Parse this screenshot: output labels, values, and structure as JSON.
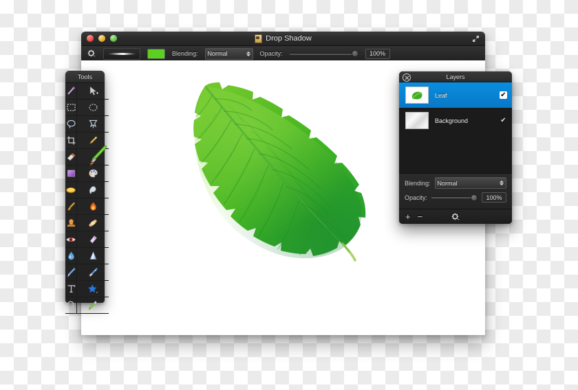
{
  "window": {
    "title": "Drop Shadow",
    "title_icon": "document-icon",
    "traffic_lights": [
      "close",
      "minimize",
      "zoom"
    ],
    "expand_icon": "expand-arrows-icon"
  },
  "toolbar": {
    "gear_icon": "gear-icon",
    "brush_preview_label": "Brush preview",
    "color_swatch": "#5bd01e",
    "blending_label": "Blending:",
    "blending_value": "Normal",
    "opacity_label": "Opacity:",
    "opacity_value": "100%",
    "opacity_percent": 100
  },
  "tools": {
    "title": "Tools",
    "active_index": 9,
    "items": [
      {
        "name": "magic-wand-tool",
        "icon": "magic-wand-icon"
      },
      {
        "name": "move-tool",
        "icon": "arrow-move-icon"
      },
      {
        "name": "rectangular-marquee-tool",
        "icon": "rect-select-icon"
      },
      {
        "name": "elliptical-marquee-tool",
        "icon": "ellipse-select-icon"
      },
      {
        "name": "lasso-tool",
        "icon": "lasso-icon"
      },
      {
        "name": "polygonal-lasso-tool",
        "icon": "polygon-lasso-icon"
      },
      {
        "name": "crop-tool",
        "icon": "crop-icon"
      },
      {
        "name": "pencil-tool",
        "icon": "pencil-icon"
      },
      {
        "name": "eraser-tool",
        "icon": "eraser-icon"
      },
      {
        "name": "paintbrush-tool",
        "icon": "paintbrush-icon"
      },
      {
        "name": "gradient-tool",
        "icon": "gradient-icon"
      },
      {
        "name": "clone-stamp-tool",
        "icon": "palette-icon"
      },
      {
        "name": "paint-bucket-tool",
        "icon": "paint-bucket-icon"
      },
      {
        "name": "smudge-tool",
        "icon": "smudge-icon"
      },
      {
        "name": "blur-tool",
        "icon": "blur-brush-icon"
      },
      {
        "name": "burn-tool",
        "icon": "flame-icon"
      },
      {
        "name": "stamp-tool",
        "icon": "rubber-stamp-icon"
      },
      {
        "name": "bandage-tool",
        "icon": "bandage-icon"
      },
      {
        "name": "red-eye-tool",
        "icon": "red-eye-icon"
      },
      {
        "name": "sharpen-tool",
        "icon": "sharpen-icon"
      },
      {
        "name": "water-drop-tool",
        "icon": "water-drop-icon"
      },
      {
        "name": "cone-gradient-tool",
        "icon": "cone-icon"
      },
      {
        "name": "pen-tool",
        "icon": "pen-icon"
      },
      {
        "name": "highlighter-tool",
        "icon": "highlighter-icon"
      },
      {
        "name": "type-tool",
        "icon": "text-t-icon"
      },
      {
        "name": "shape-tool",
        "icon": "star-shape-icon"
      },
      {
        "name": "zoom-tool",
        "icon": "magnifier-icon"
      },
      {
        "name": "eyedropper-tool",
        "icon": "eyedropper-icon"
      }
    ]
  },
  "layers": {
    "title": "Layers",
    "close_icon": "close-circle-icon",
    "items": [
      {
        "name": "Leaf",
        "selected": true,
        "visible": true,
        "thumb": "leaf-thumbnail",
        "check": "✔"
      },
      {
        "name": "Background",
        "selected": false,
        "visible": true,
        "thumb": "background-thumbnail",
        "check": "✔"
      }
    ],
    "blending_label": "Blending:",
    "blending_value": "Normal",
    "opacity_label": "Opacity:",
    "opacity_value": "100%",
    "opacity_percent": 100,
    "footer": {
      "add_label": "+",
      "remove_label": "−",
      "gear_icon": "gear-icon"
    }
  },
  "canvas": {
    "artwork_name": "green-leaf-image",
    "background": "#ffffff"
  }
}
